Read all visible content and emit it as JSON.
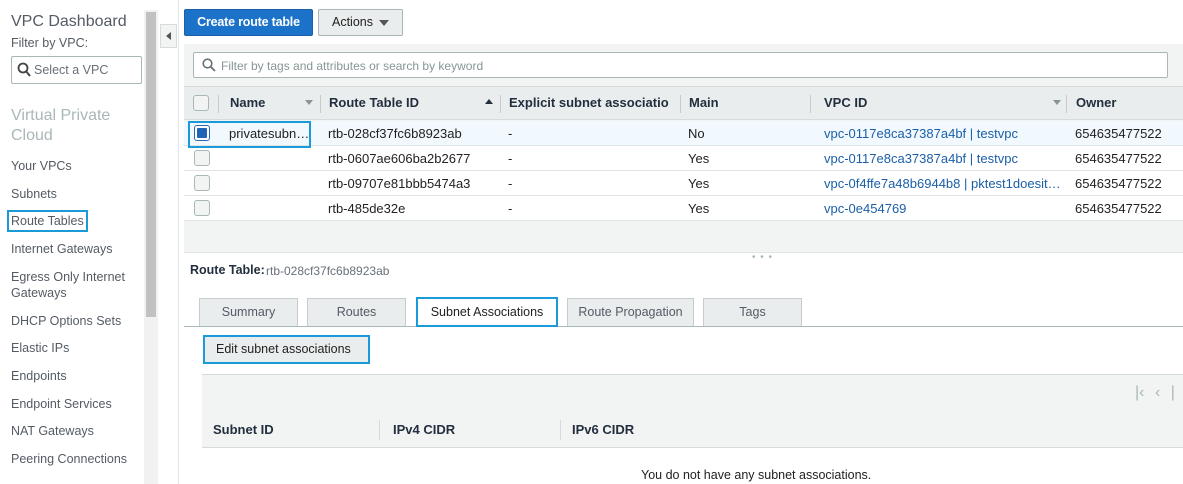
{
  "sidebar": {
    "title": "VPC Dashboard",
    "filter_label": "Filter by VPC:",
    "select_placeholder": "Select a VPC",
    "section": "Virtual Private Cloud",
    "items": [
      {
        "label": "Your VPCs"
      },
      {
        "label": "Subnets"
      },
      {
        "label": "Route Tables"
      },
      {
        "label": "Internet Gateways"
      },
      {
        "label": "Egress Only Internet Gateways"
      },
      {
        "label": "DHCP Options Sets"
      },
      {
        "label": "Elastic IPs"
      },
      {
        "label": "Endpoints"
      },
      {
        "label": "Endpoint Services"
      },
      {
        "label": "NAT Gateways"
      },
      {
        "label": "Peering Connections"
      }
    ]
  },
  "toolbar": {
    "create_label": "Create route table",
    "actions_label": "Actions"
  },
  "search": {
    "placeholder": "Filter by tags and attributes or search by keyword"
  },
  "table": {
    "headers": {
      "name": "Name",
      "route_table_id": "Route Table ID",
      "explicit": "Explicit subnet associatior",
      "main": "Main",
      "vpc_id": "VPC ID",
      "owner": "Owner"
    },
    "rows": [
      {
        "name": "privatesubn…",
        "id": "rtb-028cf37fc6b8923ab",
        "explicit": "-",
        "main": "No",
        "vpc": "vpc-0117e8ca37387a4bf | testvpc",
        "owner": "654635477522",
        "selected": true
      },
      {
        "name": "",
        "id": "rtb-0607ae606ba2b2677",
        "explicit": "-",
        "main": "Yes",
        "vpc": "vpc-0117e8ca37387a4bf | testvpc",
        "owner": "654635477522",
        "selected": false
      },
      {
        "name": "",
        "id": "rtb-09707e81bbb5474a3",
        "explicit": "-",
        "main": "Yes",
        "vpc": "vpc-0f4ffe7a48b6944b8 | pktest1doesit…",
        "owner": "654635477522",
        "selected": false
      },
      {
        "name": "",
        "id": "rtb-485de32e",
        "explicit": "-",
        "main": "Yes",
        "vpc": "vpc-0e454769",
        "owner": "654635477522",
        "selected": false
      }
    ]
  },
  "detail": {
    "label": "Route Table:",
    "value": "rtb-028cf37fc6b8923ab",
    "tabs": [
      {
        "label": "Summary"
      },
      {
        "label": "Routes"
      },
      {
        "label": "Subnet Associations"
      },
      {
        "label": "Route Propagation"
      },
      {
        "label": "Tags"
      }
    ],
    "edit_label": "Edit subnet associations",
    "sub_headers": {
      "subnet": "Subnet ID",
      "ipv4": "IPv4 CIDR",
      "ipv6": "IPv6 CIDR"
    },
    "empty_message": "You do not have any subnet associations."
  },
  "colors": {
    "primary": "#1a73c9",
    "highlight": "#1a9bd8",
    "link": "#1a5fa8"
  }
}
